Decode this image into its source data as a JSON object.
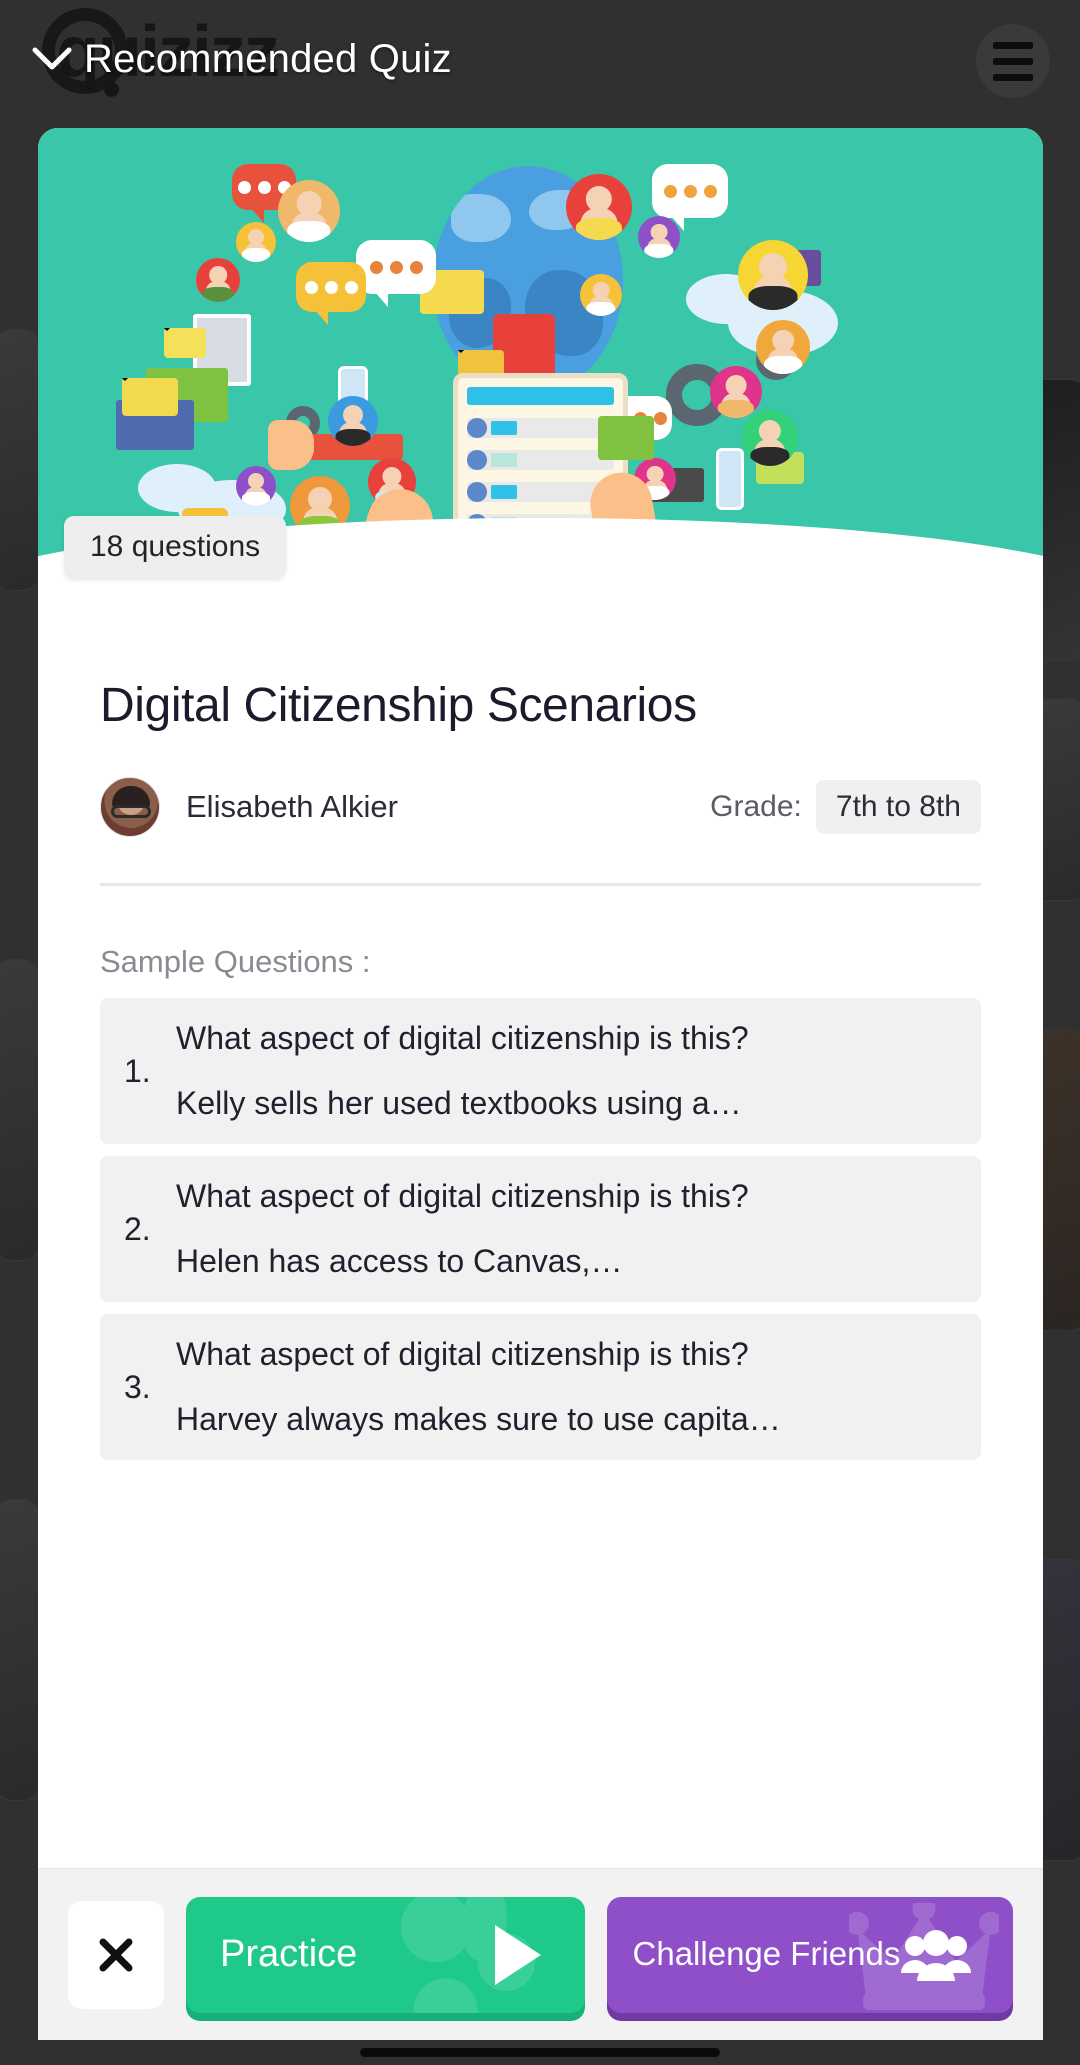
{
  "header": {
    "brand": "quizizz",
    "back_icon": "chevron-down-icon",
    "title": "Recommended Quiz",
    "menu_icon": "hamburger-menu-icon"
  },
  "hero": {
    "questions_badge": "18 questions",
    "illustration": "digital-communication-illustration",
    "background_color": "#3ac6a8"
  },
  "quiz": {
    "title": "Digital Citizenship Scenarios",
    "author": "Elisabeth Alkier",
    "author_avatar": "author-avatar",
    "grade_label": "Grade:",
    "grade_value": "7th to 8th"
  },
  "sample": {
    "heading": "Sample Questions :",
    "questions": [
      {
        "number": "1.",
        "prompt": "What aspect of digital citizenship is this?",
        "detail": "Kelly sells her used textbooks using a…"
      },
      {
        "number": "2.",
        "prompt": "What aspect of digital citizenship is this?",
        "detail": "Helen has access to Canvas,…"
      },
      {
        "number": "3.",
        "prompt": "What aspect of digital citizenship is this?",
        "detail": "Harvey always makes sure to use capita…"
      }
    ]
  },
  "actions": {
    "close_icon": "close-x-icon",
    "practice_label": "Practice",
    "practice_icon": "play-icon",
    "practice_color": "#1fc98a",
    "challenge_label": "Challenge Friends",
    "challenge_icon": "people-group-icon",
    "challenge_color": "#8e4fc9"
  }
}
